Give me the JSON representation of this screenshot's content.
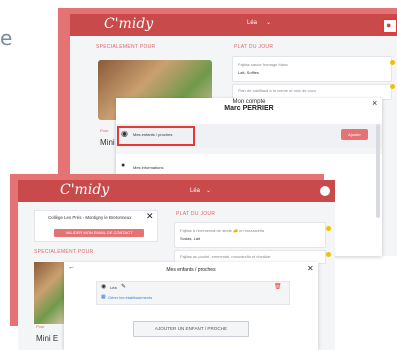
{
  "caption": {
    "edge_text": "e"
  },
  "top_screen": {
    "logo": "C'midy",
    "user": "Léa",
    "user_chevron": "⌄",
    "section_left": "SPECIALEMENT POUR",
    "section_right": "PLAT DU JOUR",
    "card_tag": "Pour",
    "card_label": "Mini E",
    "right_cards": [
      {
        "line1": "Fajitas sauce fromage blanc",
        "line2": "Lait, Soffies"
      },
      {
        "line1": "Flan de cabillaud à la crème et noix de coco",
        "line2": ""
      }
    ],
    "modal": {
      "title": "Mon compte",
      "name": "Marc PERRIER",
      "close": "×",
      "row1_label": "Mes enfants / proches",
      "add_button": "Ajouter",
      "row2_label": "Mes informations"
    }
  },
  "bottom_screen": {
    "logo": "C'midy",
    "user": "Léa",
    "user_chevron": "⌄",
    "school_card": {
      "name": "Collège Les Prés - Montigny le Bretonneux",
      "close": "✕",
      "button": "VALIDER MON EMAIL DE CONTACT"
    },
    "section_left": "SPECIALEMENT POUR",
    "section_right": "PLAT DU JOUR",
    "card_tag": "Pour",
    "card_label": "Mini E",
    "right_cards": [
      {
        "line1": "Fajitas à l'emmental de dinde 🧀 en mozzarella",
        "line2": "Sodas, Lait"
      },
      {
        "line1": "Fajitas au poulet, emmental, mozzarella et cheddar",
        "line2": ""
      }
    ],
    "modal": {
      "back": "←",
      "title": "Mes enfants / proches",
      "close": "✕",
      "child_name": "Léa",
      "link_label": "Gérer les établissements",
      "add_button": "AJOUTER UN ENFANT / PROCHE"
    }
  },
  "colors": {
    "brand": "#c94a4a",
    "accent": "#e57373",
    "highlight": "#e53935",
    "link": "#2f7fd6"
  }
}
